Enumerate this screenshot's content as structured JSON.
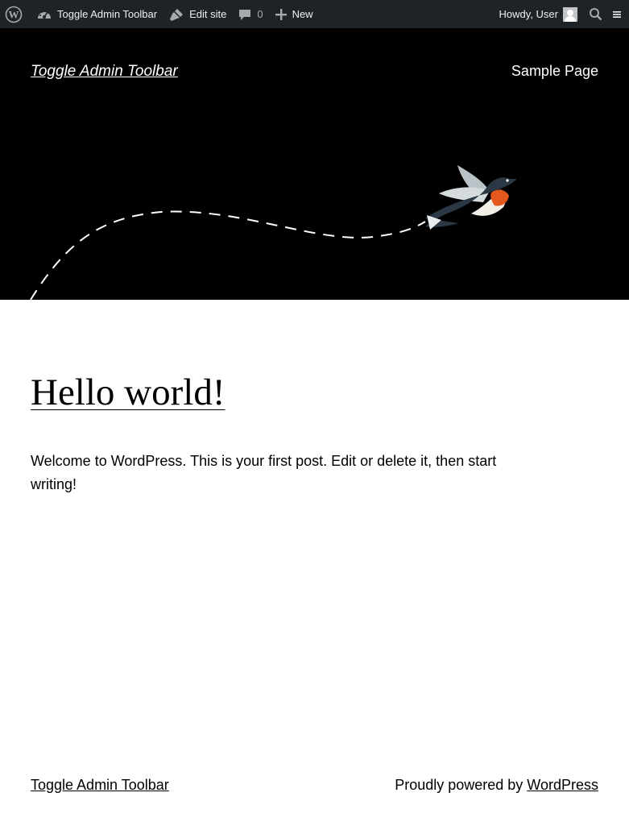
{
  "admin_bar": {
    "wp_logo_icon": "wordpress-logo-icon",
    "site_name": "Toggle Admin Toolbar",
    "edit_site": "Edit site",
    "comments_count": "0",
    "new_label": "New",
    "howdy": "Howdy, User",
    "colors": {
      "background": "#1d2327",
      "text": "#f0f0f1"
    }
  },
  "header": {
    "site_title": "Toggle Admin Toolbar",
    "nav": [
      {
        "label": "Sample Page"
      }
    ],
    "background_color": "#000000"
  },
  "post": {
    "title": "Hello world!",
    "body": "Welcome to WordPress. This is your first post. Edit or delete it, then start writing!"
  },
  "footer": {
    "site_title": "Toggle Admin Toolbar",
    "credit_prefix": "Proudly powered by ",
    "credit_link": "WordPress"
  }
}
